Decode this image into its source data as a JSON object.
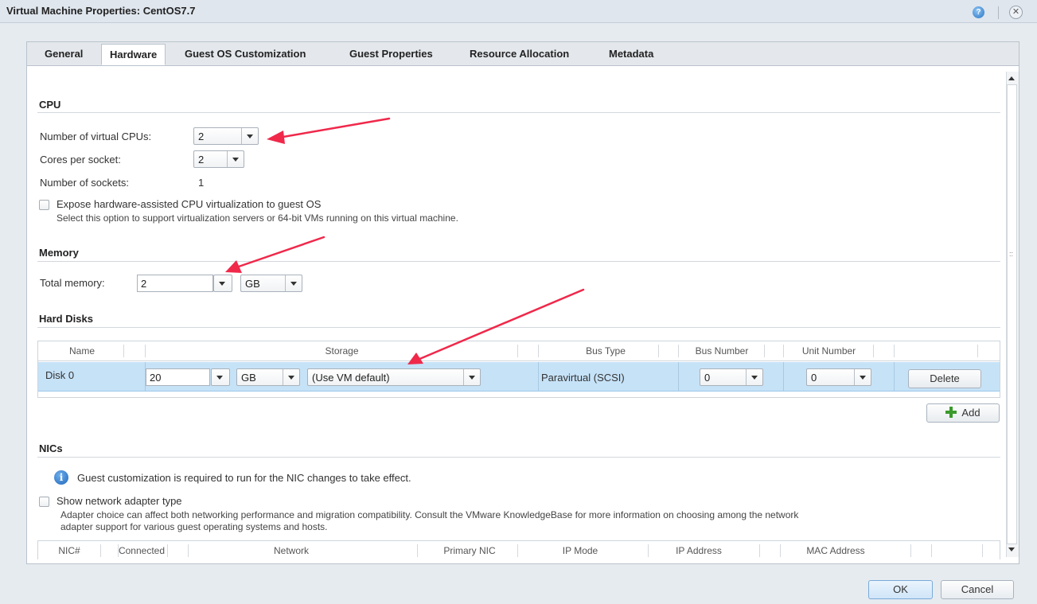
{
  "window": {
    "title": "Virtual Machine Properties: CentOS7.7",
    "help_glyph": "?",
    "close_glyph": "✕"
  },
  "tabs": [
    {
      "label": "General"
    },
    {
      "label": "Hardware",
      "active": true
    },
    {
      "label": "Guest OS Customization"
    },
    {
      "label": "Guest Properties"
    },
    {
      "label": "Resource Allocation"
    },
    {
      "label": "Metadata"
    }
  ],
  "cpu": {
    "title": "CPU",
    "vcpus_label": "Number of virtual CPUs:",
    "vcpus_value": "2",
    "cores_label": "Cores per socket:",
    "cores_value": "2",
    "sockets_label": "Number of sockets:",
    "sockets_value": "1",
    "expose_label": "Expose hardware-assisted CPU virtualization to guest OS",
    "expose_help": "Select this option to support virtualization servers or 64-bit VMs running on this virtual machine."
  },
  "memory": {
    "title": "Memory",
    "total_label": "Total memory:",
    "total_value": "2",
    "unit_value": "GB"
  },
  "hard_disks": {
    "title": "Hard Disks",
    "columns": [
      "Name",
      "Storage",
      "Bus Type",
      "Bus Number",
      "Unit Number"
    ],
    "rows": [
      {
        "name": "Disk 0",
        "size": "20",
        "size_unit": "GB",
        "storage_policy": "(Use VM default)",
        "bus_type": "Paravirtual (SCSI)",
        "bus_number": "0",
        "unit_number": "0",
        "delete_label": "Delete"
      }
    ],
    "add_label": "Add"
  },
  "nics": {
    "title": "NICs",
    "info": "Guest customization is required to run for the NIC changes to take effect.",
    "show_type_label": "Show network adapter type",
    "show_type_help_1": "Adapter choice can affect both networking performance and migration compatibility. Consult the VMware KnowledgeBase for more information on choosing among the network",
    "show_type_help_2": "adapter support for various guest operating systems and hosts.",
    "columns": [
      "NIC#",
      "Connected",
      "Network",
      "Primary NIC",
      "IP Mode",
      "IP Address",
      "MAC Address"
    ]
  },
  "footer": {
    "ok_label": "OK",
    "cancel_label": "Cancel"
  },
  "colors": {
    "accent_arrow": "#f0284a",
    "selected_row": "#c6e2f7",
    "add_icon": "#3a9a2a"
  }
}
